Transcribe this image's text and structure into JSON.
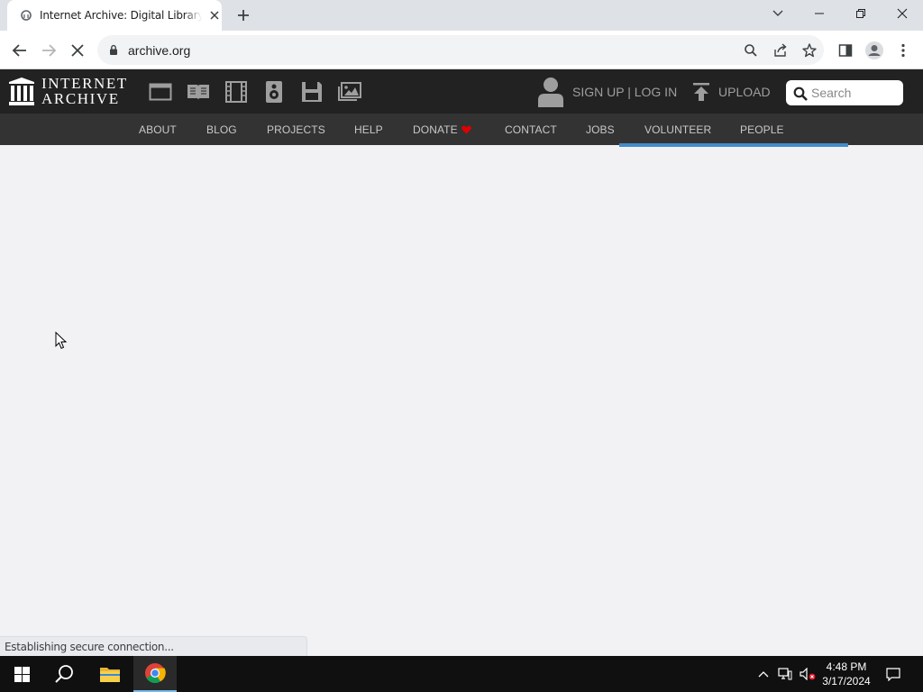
{
  "browser": {
    "tab": {
      "title": "Internet Archive: Digital Library of Free & Borrowable Books, Movies, Music & Wayback Machine",
      "favicon": "internet-archive-favicon"
    },
    "omnibox": {
      "url": "archive.org"
    },
    "status": "Establishing secure connection..."
  },
  "site": {
    "wordmark_line1": "INTERNET",
    "wordmark_line2": "ARCHIVE",
    "media_icons": [
      "web-icon",
      "texts-icon",
      "video-icon",
      "audio-icon",
      "software-icon",
      "images-icon"
    ],
    "signup": "SIGN UP | LOG IN",
    "upload": "UPLOAD",
    "search_placeholder": "Search",
    "nav": [
      "ABOUT",
      "BLOG",
      "PROJECTS",
      "HELP",
      "DONATE",
      "CONTACT",
      "JOBS",
      "VOLUNTEER",
      "PEOPLE"
    ],
    "colors": {
      "header_bg": "#222222",
      "nav_bg": "#333333",
      "accent": "#428bca",
      "donate_heart": "#e00000"
    }
  },
  "taskbar": {
    "time": "4:48 PM",
    "date": "3/17/2024"
  }
}
